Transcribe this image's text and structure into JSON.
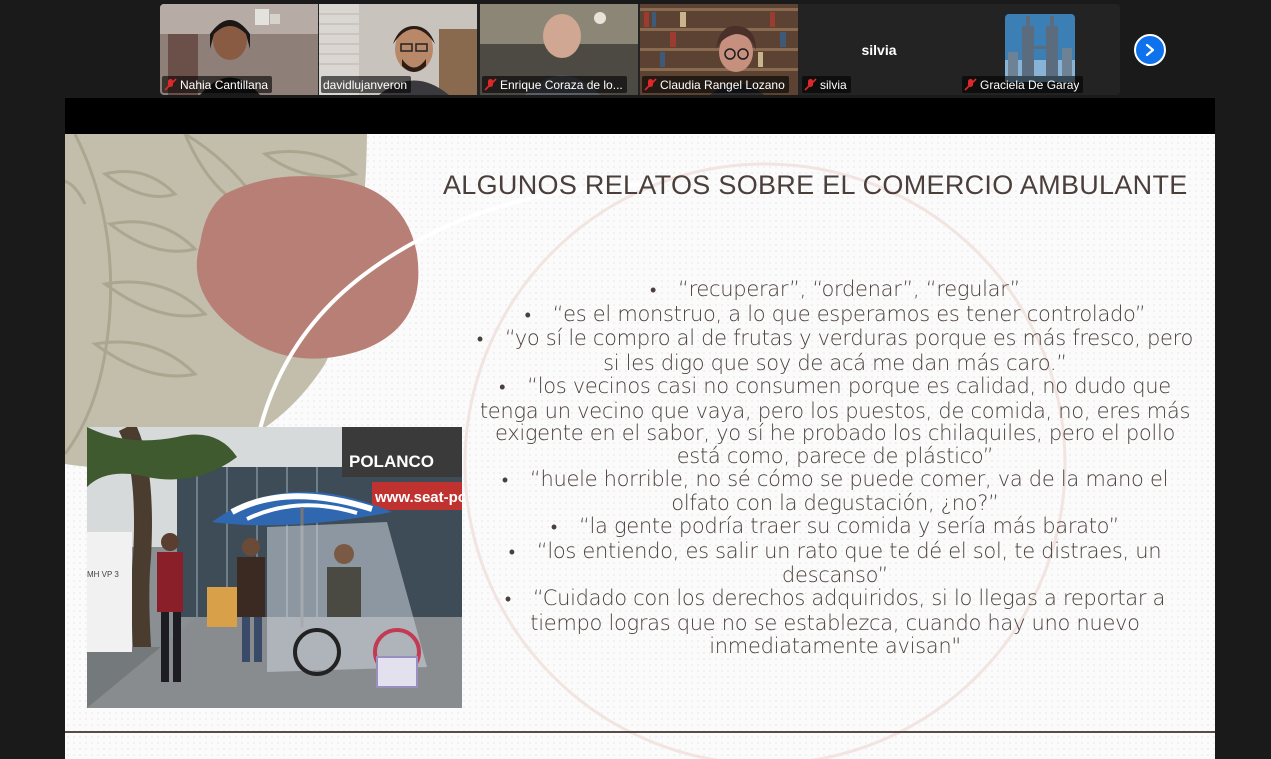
{
  "participants": [
    {
      "name": "Nahia Cantillana",
      "muted": true,
      "active": false
    },
    {
      "name": "davidlujanveron",
      "muted": false,
      "active": true
    },
    {
      "name": "Enrique Coraza de lo...",
      "muted": true,
      "active": false
    },
    {
      "name": "Claudia Rangel Lozano",
      "muted": true,
      "active": false
    },
    {
      "name": "silvia",
      "muted": true,
      "active": false,
      "display_name": "silvia"
    },
    {
      "name": "Graciela De Garay",
      "muted": true,
      "active": false
    }
  ],
  "gallery": {
    "next_icon": "chevron-right-icon"
  },
  "slide": {
    "title": "ALGUNOS RELATOS SOBRE EL COMERCIO AMBULANTE",
    "bullets": [
      "“recuperar”, “ordenar”, “regular”",
      "“es el monstruo, a lo que esperamos es tener controlado”",
      "“yo sí le compro al de frutas y verduras porque es más fresco, pero si les digo que soy de acá me dan más caro.”",
      "“los vecinos casi no consumen porque es calidad, no dudo que tenga un vecino que vaya, pero los puestos, de comida, no, eres más exigente en el sabor, yo sí he probado los chilaquiles, pero el pollo está como, parece de plástico”",
      "“huele horrible, no sé cómo se puede comer, va de la mano el olfato con la degustación, ¿no?”",
      "“la gente podría traer su comida y sería más barato”",
      "“los entiendo, es salir un rato que te dé el sol, te distraes, un descanso”",
      "“Cuidado con los derechos adquiridos, si lo llegas a reportar a tiempo logras que no se establezca, cuando hay uno nuevo inmediatamente avisan\""
    ],
    "photo_sign": "POLANCO",
    "photo_sign2": "www.seat-pola",
    "photo_plate": "MH VP 3"
  },
  "colors": {
    "active_speaker": "#23d160",
    "accent_blue": "#0e72ed",
    "leaf": "#bdb9a4",
    "blob": "#b77f75",
    "text": "#4a3f3b"
  }
}
